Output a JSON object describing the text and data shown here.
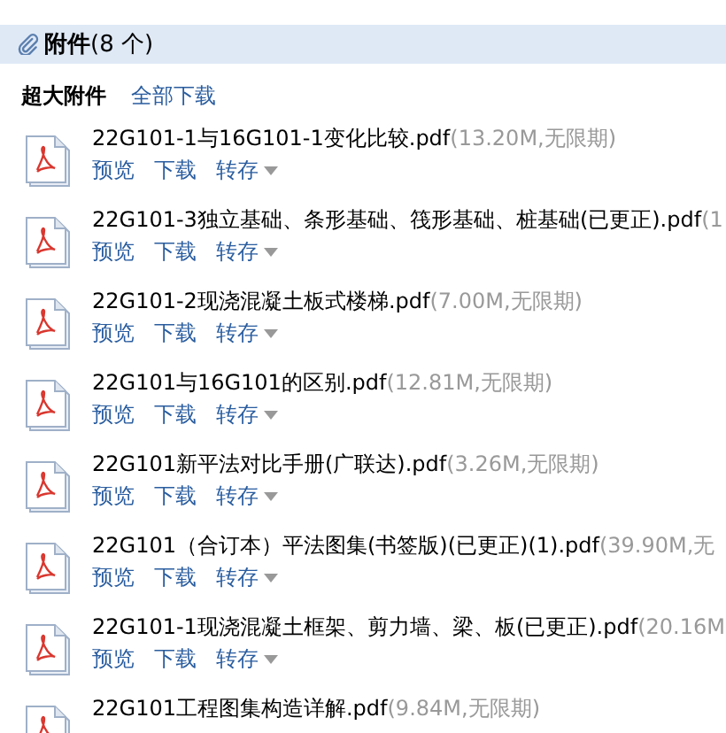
{
  "header": {
    "title": "附件",
    "count": "(8 个)"
  },
  "toolbar": {
    "label": "超大附件",
    "link": "全部下载"
  },
  "attachments": [
    {
      "name": "22G101-1与16G101-1变化比较.pdf",
      "meta": "(13.20M,无限期)",
      "actions": [
        "预览",
        "下载",
        "转存"
      ]
    },
    {
      "name": "22G101-3独立基础、条形基础、筏形基础、桩基础(已更正).pdf",
      "meta": "(1",
      "actions": [
        "预览",
        "下载",
        "转存"
      ]
    },
    {
      "name": "22G101-2现浇混凝土板式楼梯.pdf",
      "meta": "(7.00M,无限期)",
      "actions": [
        "预览",
        "下载",
        "转存"
      ]
    },
    {
      "name": "22G101与16G101的区别.pdf",
      "meta": "(12.81M,无限期)",
      "actions": [
        "预览",
        "下载",
        "转存"
      ]
    },
    {
      "name": "22G101新平法对比手册(广联达).pdf",
      "meta": "(3.26M,无限期)",
      "actions": [
        "预览",
        "下载",
        "转存"
      ]
    },
    {
      "name": "22G101（合订本）平法图集(书签版)(已更正)(1).pdf",
      "meta": "(39.90M,无",
      "actions": [
        "预览",
        "下载",
        "转存"
      ]
    },
    {
      "name": "22G101-1现浇混凝土框架、剪力墙、梁、板(已更正).pdf",
      "meta": "(20.16M",
      "actions": [
        "预览",
        "下载",
        "转存"
      ]
    },
    {
      "name": "22G101工程图集构造详解.pdf",
      "meta": "(9.84M,无限期)"
    }
  ]
}
